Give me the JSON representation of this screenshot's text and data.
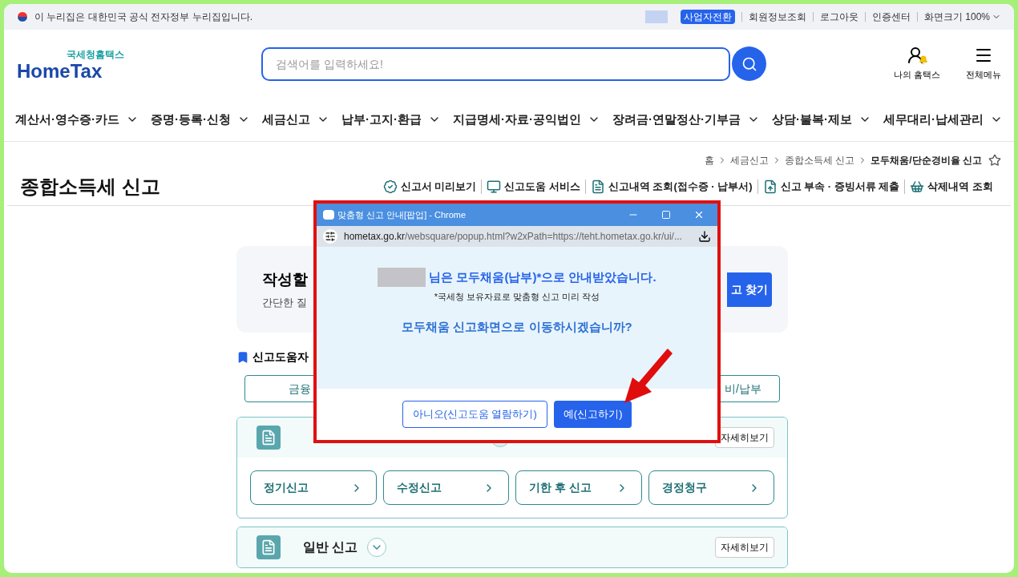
{
  "top_bar": {
    "notice": "이 누리집은 대한민국 공식 전자정부 누리집입니다.",
    "switch_button": "사업자전환",
    "links": [
      "회원정보조회",
      "로그아웃",
      "인증센터"
    ],
    "zoom": "화면크기 100%"
  },
  "header": {
    "logo_small": "국세청홈택스",
    "logo": "HomeTax",
    "search_placeholder": "검색어를 입력하세요!",
    "user_menu": [
      {
        "label": "나의 홈택스",
        "kind": "user"
      },
      {
        "label": "전체메뉴",
        "kind": "menu"
      }
    ]
  },
  "nav": [
    "계산서·영수증·카드",
    "증명·등록·신청",
    "세금신고",
    "납부·고지·환급",
    "지급명세·자료·공익법인",
    "장려금·연말정산·기부금",
    "상담·불복·제보",
    "세무대리·납세관리"
  ],
  "breadcrumb": [
    "홈",
    "세금신고",
    "종합소득세 신고",
    "모두채움/단순경비율 신고"
  ],
  "page_title": "종합소득세 신고",
  "tools": [
    {
      "label": "신고서 미리보기",
      "kind": "check"
    },
    {
      "label": "신고도움 서비스",
      "kind": "monitor"
    },
    {
      "label": "신고내역 조회(접수증 · 납부서)",
      "kind": "doc"
    },
    {
      "label": "신고 부속 · 증빙서류 제출",
      "kind": "upload"
    },
    {
      "label": "삭제내역 조회",
      "kind": "basket"
    }
  ],
  "card": {
    "title": "작성할",
    "text": "간단한 질",
    "button": "고 찾기"
  },
  "help": {
    "title": "신고도움자",
    "tabs": [
      "금융",
      "비/납부"
    ]
  },
  "panels": [
    {
      "detail": "자세히보기",
      "expanded": true,
      "buttons": [
        "정기신고",
        "수정신고",
        "기한 후 신고",
        "경정청구"
      ]
    },
    {
      "title": "일반 신고",
      "detail": "자세히보기",
      "expanded": false
    }
  ],
  "popup": {
    "title": "맞춤형 신고 안내[팝업] - Chrome",
    "url_host": "hometax.go.kr",
    "url_path": "/websquare/popup.html?w2xPath=https://teht.hometax.go.kr/ui/...",
    "message": "님은 모두채움(납부)*으로 안내받았습니다.",
    "note": "*국세청 보유자료로 맞춤형 신고 미리 작성",
    "question": "모두채움 신고화면으로 이동하시겠습니까?",
    "buttons": [
      {
        "label": "아니오(신고도움 열람하기)",
        "primary": false
      },
      {
        "label": "예(신고하기)",
        "primary": true
      }
    ]
  }
}
